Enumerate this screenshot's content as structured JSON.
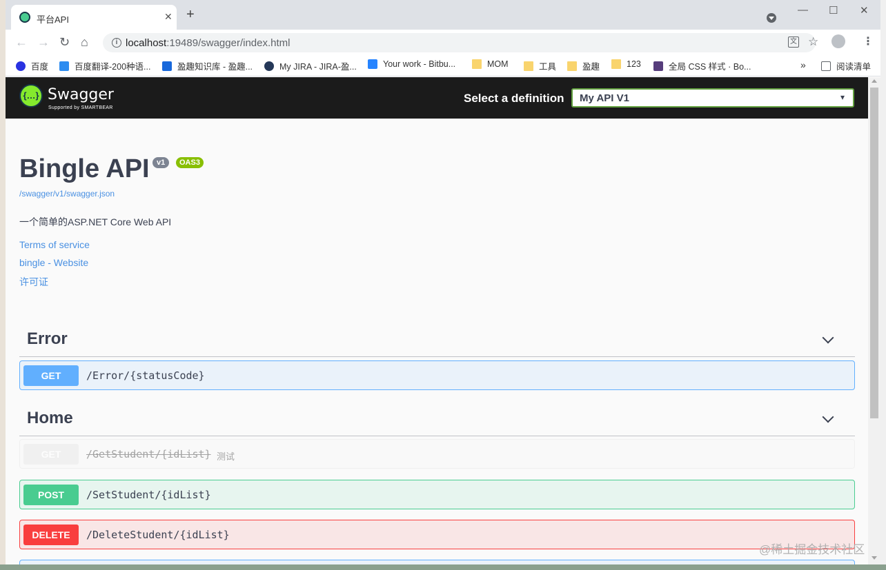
{
  "browser": {
    "tab_title": "平台API",
    "url_host": "localhost",
    "url_rest": ":19489/swagger/index.html",
    "bookmarks": [
      "百度",
      "百度翻译-200种语...",
      "盈趣知识库 - 盈趣...",
      "My JIRA - JIRA-盈...",
      "Your work - Bitbu...",
      "MOM",
      "工具",
      "盈趣",
      "123",
      "全局 CSS 样式 · Bo...",
      "阅读清单"
    ],
    "overflow_glyph": "»"
  },
  "topbar": {
    "logo_text": "Swagger",
    "logo_sub": "Supported by SMARTBEAR",
    "definition_label": "Select a definition",
    "definition_value": "My API V1"
  },
  "info": {
    "title": "Bingle API",
    "version_badge": "v1",
    "oas_badge": "OAS3",
    "json_link": "/swagger/v1/swagger.json",
    "description": "一个简单的ASP.NET Core Web API",
    "terms": "Terms of service",
    "contact": "bingle - Website",
    "license": "许可证"
  },
  "tags": [
    {
      "name": "Error",
      "operations": [
        {
          "method": "GET",
          "path": "/Error/{statusCode}",
          "summary": ""
        }
      ]
    },
    {
      "name": "Home",
      "operations": [
        {
          "method": "GET",
          "path": "/GetStudent/{idList}",
          "summary": "测试",
          "deprecated": true
        },
        {
          "method": "POST",
          "path": "/SetStudent/{idList}",
          "summary": ""
        },
        {
          "method": "DELETE",
          "path": "/DeleteStudent/{idList}",
          "summary": ""
        }
      ]
    }
  ],
  "watermark": "@稀土掘金技术社区",
  "colors": {
    "get": "#61affe",
    "post": "#49cc90",
    "delete": "#f93e3e",
    "swagger_green": "#85ea2d",
    "oas_badge": "#89bf04"
  }
}
